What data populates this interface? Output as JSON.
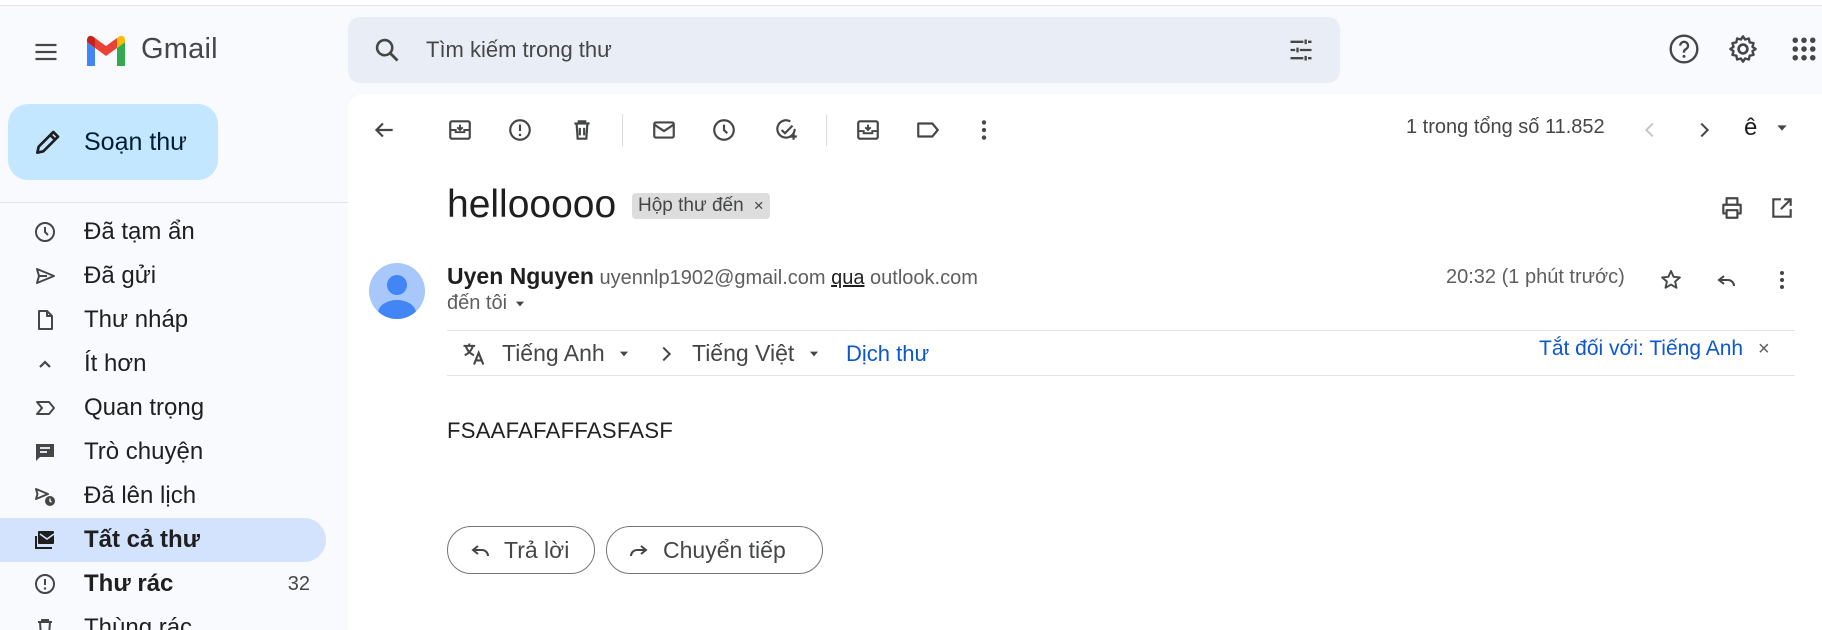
{
  "app": {
    "name": "Gmail",
    "brand_color": "#c5221f"
  },
  "search": {
    "placeholder": "Tìm kiếm trong thư"
  },
  "compose": {
    "label": "Soạn thư"
  },
  "sidebar": {
    "items": [
      {
        "label": "Đã tạm ẩn",
        "icon": "clock-icon"
      },
      {
        "label": "Đã gửi",
        "icon": "send-icon"
      },
      {
        "label": "Thư nháp",
        "icon": "draft-icon"
      },
      {
        "label": "Ít hơn",
        "icon": "chevron-up-icon"
      },
      {
        "label": "Quan trọng",
        "icon": "important-icon"
      },
      {
        "label": "Trò chuyện",
        "icon": "chat-icon"
      },
      {
        "label": "Đã lên lịch",
        "icon": "scheduled-icon"
      },
      {
        "label": "Tất cả thư",
        "icon": "all-mail-icon",
        "active": true
      },
      {
        "label": "Thư rác",
        "icon": "spam-icon",
        "count": "32"
      },
      {
        "label": "Thùng rác",
        "icon": "trash-icon"
      }
    ]
  },
  "toolbar": {
    "pager_text": "1 trong tổng số 11.852",
    "input_tool": "ê"
  },
  "message": {
    "subject": "hellooooo",
    "label": "Hộp thư đến",
    "label_close": "×",
    "sender_name": "Uyen Nguyen",
    "sender_email": "uyennlp1902@gmail.com",
    "via_word": "qua",
    "via_domain": "outlook.com",
    "to": "đến tôi",
    "time": "20:32 (1 phút trước)",
    "body": "FSAAFAFAFFASFASF"
  },
  "translation": {
    "from_lang": "Tiếng Anh",
    "to_lang": "Tiếng Việt",
    "translate_link": "Dịch thư",
    "turn_off": "Tắt đối với: Tiếng Anh",
    "close": "×"
  },
  "actions": {
    "reply": "Trả lời",
    "forward": "Chuyển tiếp"
  }
}
